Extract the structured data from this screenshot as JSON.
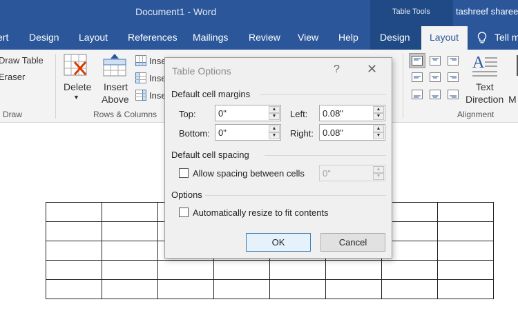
{
  "titlebar": {
    "doc_title": "Document1  -  Word",
    "context_label": "Table Tools",
    "user": "tashreef sharee"
  },
  "tabs": [
    "ert",
    "Design",
    "Layout",
    "References",
    "Mailings",
    "Review",
    "View",
    "Help",
    "Design"
  ],
  "active_tab": "Layout",
  "tell_me": "Tell m",
  "ribbon": {
    "draw_table": "Draw Table",
    "eraser": "Eraser",
    "draw_group": "Draw",
    "delete": "Delete",
    "insert_above_1": "Insert",
    "insert_above_2": "Above",
    "insert_below": "Inse",
    "insert_left": "Inse",
    "insert_right": "Inse",
    "rows_columns_group": "Rows & Columns",
    "text_direction_1": "Text",
    "text_direction_2": "Direction",
    "alignment_group": "Alignment",
    "cell_margins_cut": "M"
  },
  "dialog": {
    "title": "Table Options",
    "help": "?",
    "close": "✕",
    "margins_heading": "Default cell margins",
    "top_label": "Top:",
    "top_value": "0\"",
    "bottom_label": "Bottom:",
    "bottom_value": "0\"",
    "left_label": "Left:",
    "left_value": "0.08\"",
    "right_label": "Right:",
    "right_value": "0.08\"",
    "spacing_heading": "Default cell spacing",
    "allow_spacing_label": "Allow spacing between cells",
    "allow_spacing_checked": false,
    "spacing_value": "0\"",
    "options_heading": "Options",
    "autoresize_label": "Automatically resize to fit contents",
    "autoresize_checked": false,
    "ok_label": "OK",
    "cancel_label": "Cancel"
  },
  "colors": {
    "title_blue": "#2b579a",
    "context_blue": "#1f4a86",
    "ribbon_bg": "#f3f3f3",
    "dialog_bg": "#f0f0f0",
    "ok_border": "#3c7fb1"
  },
  "table": {
    "rows": 5,
    "cols": 8
  }
}
